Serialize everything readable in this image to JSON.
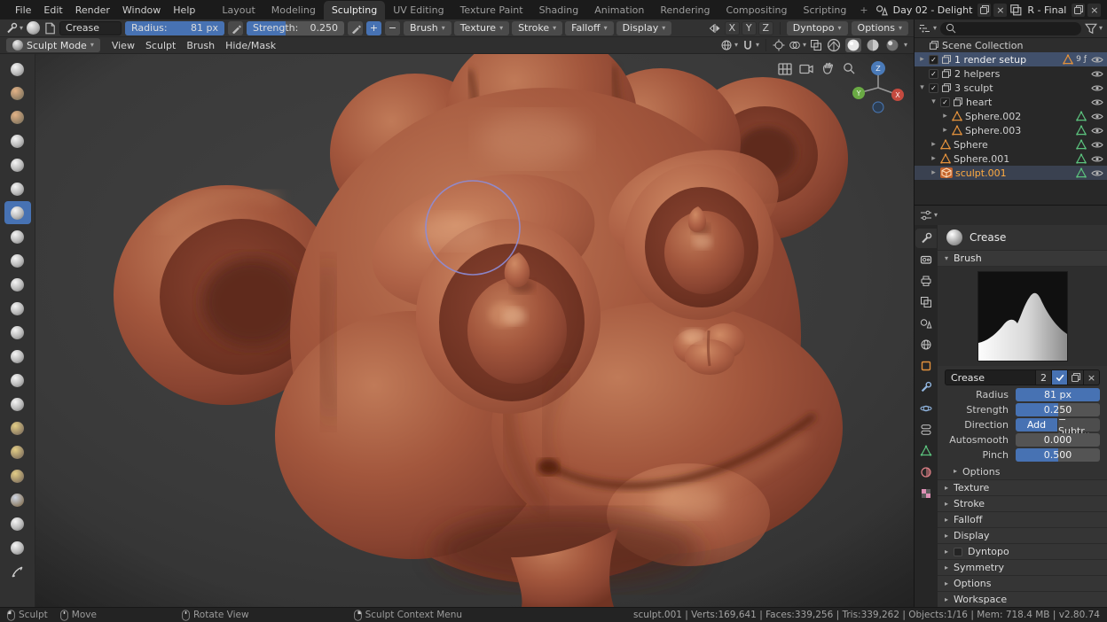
{
  "topbar": {
    "menus": [
      "File",
      "Edit",
      "Render",
      "Window",
      "Help"
    ],
    "tabs": [
      "Layout",
      "Modeling",
      "Sculpting",
      "UV Editing",
      "Texture Paint",
      "Shading",
      "Animation",
      "Rendering",
      "Compositing",
      "Scripting"
    ],
    "active_tab": "Sculpting",
    "new_tab_label": "+",
    "scene_name": "Day 02 - Delight",
    "view_layer_name": "R - Final"
  },
  "tool_header": {
    "tool_name": "Crease",
    "radius_label": "Radius:",
    "radius_value": "81 px",
    "radius_fill": 1,
    "strength_label": "Strength:",
    "strength_value": "0.250",
    "strength_fill": 0.4,
    "add_label": "+",
    "subtract_label": "−",
    "menus": [
      "Brush",
      "Texture",
      "Stroke",
      "Falloff",
      "Display"
    ],
    "axis_toggles": [
      "X",
      "Y",
      "Z"
    ],
    "dyntopo_label": "Dyntopo",
    "options_label": "Options"
  },
  "viewport_header": {
    "mode_label": "Sculpt Mode",
    "menus": [
      "View",
      "Sculpt",
      "Brush",
      "Hide/Mask"
    ]
  },
  "toolbar": {
    "selected_index": 6,
    "tools": [
      "draw",
      "clay",
      "clay-strips",
      "layer",
      "inflate",
      "blob",
      "crease",
      "smooth",
      "flatten",
      "fill",
      "scrape",
      "pinch",
      "grab",
      "elastic-deform",
      "snake-hook",
      "thumb",
      "pose",
      "nudge",
      "rotate",
      "simplify",
      "mask",
      "annotate"
    ]
  },
  "viewport": {
    "gizmo": {
      "x": "X",
      "y": "Y",
      "z": "Z"
    }
  },
  "outliner": {
    "root_label": "Scene Collection",
    "rows": [
      {
        "name": "1 render setup",
        "depth": 0,
        "arrow": "right",
        "checkbox": true,
        "icon": "collection",
        "selected": true,
        "badges": [
          "mesh",
          "9",
          "ƒ"
        ],
        "eye": true
      },
      {
        "name": "2 helpers",
        "depth": 0,
        "arrow": "none",
        "checkbox": true,
        "icon": "collection",
        "eye": true
      },
      {
        "name": "3 sculpt",
        "depth": 0,
        "arrow": "down",
        "checkbox": true,
        "icon": "collection",
        "eye": true
      },
      {
        "name": "heart",
        "depth": 1,
        "arrow": "down",
        "checkbox": true,
        "icon": "collection",
        "eye": true
      },
      {
        "name": "Sphere.002",
        "depth": 2,
        "arrow": "right",
        "icon": "mesh-object",
        "data_icon": true,
        "eye": true
      },
      {
        "name": "Sphere.003",
        "depth": 2,
        "arrow": "right",
        "icon": "mesh-object",
        "data_icon": true,
        "eye": true
      },
      {
        "name": "Sphere",
        "depth": 1,
        "arrow": "right",
        "icon": "mesh-object",
        "data_icon": true,
        "eye": true
      },
      {
        "name": "Sphere.001",
        "depth": 1,
        "arrow": "right",
        "icon": "mesh-object",
        "data_icon": true,
        "eye": true
      },
      {
        "name": "sculpt.001",
        "depth": 1,
        "arrow": "right",
        "icon": "mesh-object-active",
        "data_icon": true,
        "active": true,
        "eye": true
      }
    ]
  },
  "properties": {
    "tabs": [
      "active-tool",
      "render",
      "output",
      "view-layer",
      "scene",
      "world",
      "object",
      "modifiers",
      "physics",
      "constraints",
      "object-data",
      "material",
      "texture"
    ],
    "active_tab": "active-tool",
    "active_tool_label": "Crease",
    "brush_panel_label": "Brush",
    "name_field_value": "Crease",
    "users_count": "2",
    "radius": {
      "label": "Radius",
      "value": "81 px",
      "fill": 1
    },
    "strength": {
      "label": "Strength",
      "value": "0.250",
      "fill": 0.5
    },
    "direction": {
      "label": "Direction",
      "add": "Add",
      "subtract": "− Subtr..",
      "active": "add"
    },
    "autosmooth": {
      "label": "Autosmooth",
      "value": "0.000",
      "fill": 0
    },
    "pinch": {
      "label": "Pinch",
      "value": "0.500",
      "fill": 0.5
    },
    "options_sub_label": "Options",
    "sections": [
      {
        "label": "Texture"
      },
      {
        "label": "Stroke"
      },
      {
        "label": "Falloff"
      },
      {
        "label": "Display"
      },
      {
        "label": "Dyntopo",
        "checkbox": true
      },
      {
        "label": "Symmetry"
      },
      {
        "label": "Options"
      },
      {
        "label": "Workspace"
      }
    ]
  },
  "statusbar": {
    "hints": [
      {
        "button": "left",
        "label": "Sculpt"
      },
      {
        "button": "middle",
        "label": "Move"
      },
      {
        "button": "middle",
        "label": "Rotate View"
      },
      {
        "button": "right",
        "label": "Sculpt Context Menu"
      }
    ],
    "stats": "sculpt.001 | Verts:169,641 | Faces:339,256 | Tris:339,262 | Objects:1/16 | Mem: 718.4 MB | v2.80.74"
  },
  "colors": {
    "accent": "#4772b3",
    "active_object_text": "#ffab40",
    "clay_base": "#a3573d"
  }
}
